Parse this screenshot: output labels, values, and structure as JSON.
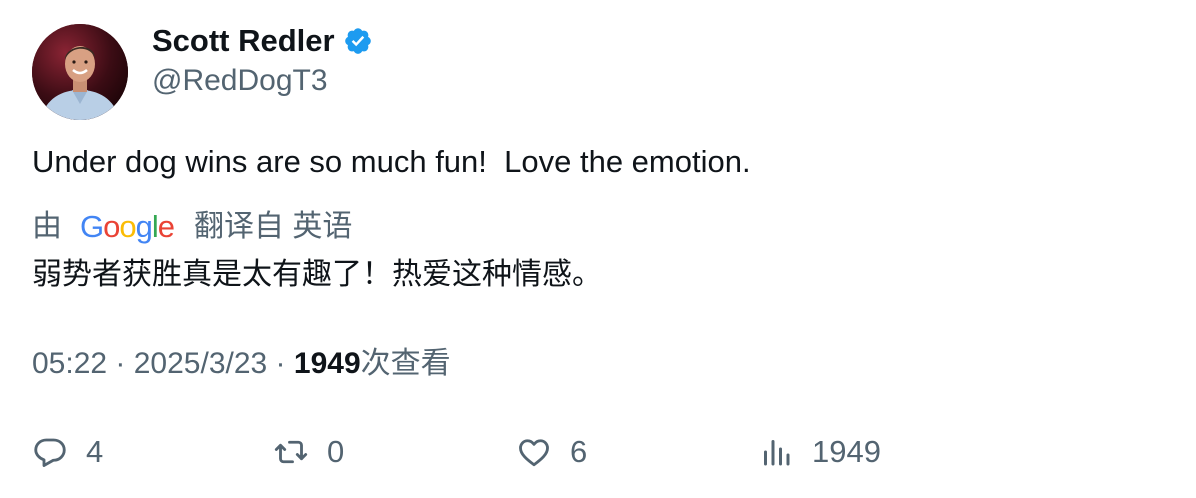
{
  "author": {
    "display_name": "Scott Redler",
    "handle": "@RedDogT3",
    "verified": true
  },
  "tweet": {
    "text": "Under dog wins are so much fun!  Love the emotion."
  },
  "translation": {
    "by_label": "由",
    "provider_letters": [
      {
        "ch": "G",
        "color": "#4285F4"
      },
      {
        "ch": "o",
        "color": "#EA4335"
      },
      {
        "ch": "o",
        "color": "#FBBC05"
      },
      {
        "ch": "g",
        "color": "#4285F4"
      },
      {
        "ch": "l",
        "color": "#34A853"
      },
      {
        "ch": "e",
        "color": "#EA4335"
      }
    ],
    "translated_from_label": "翻译自 英语",
    "translated_text": "弱势者获胜真是太有趣了！热爱这种情感。"
  },
  "meta": {
    "time": "05:22",
    "separator": " · ",
    "date": "2025/3/23",
    "separator2": " · ",
    "views_count": "1949",
    "views_label": "次查看"
  },
  "actions": {
    "reply_count": "4",
    "retweet_count": "0",
    "like_count": "6",
    "views_count": "1949"
  },
  "colors": {
    "verified_blue": "#1D9BF0",
    "secondary_text": "#536471",
    "primary_text": "#0F1419"
  },
  "icons": [
    "verified-badge-icon",
    "reply-icon",
    "retweet-icon",
    "like-icon",
    "views-icon"
  ]
}
